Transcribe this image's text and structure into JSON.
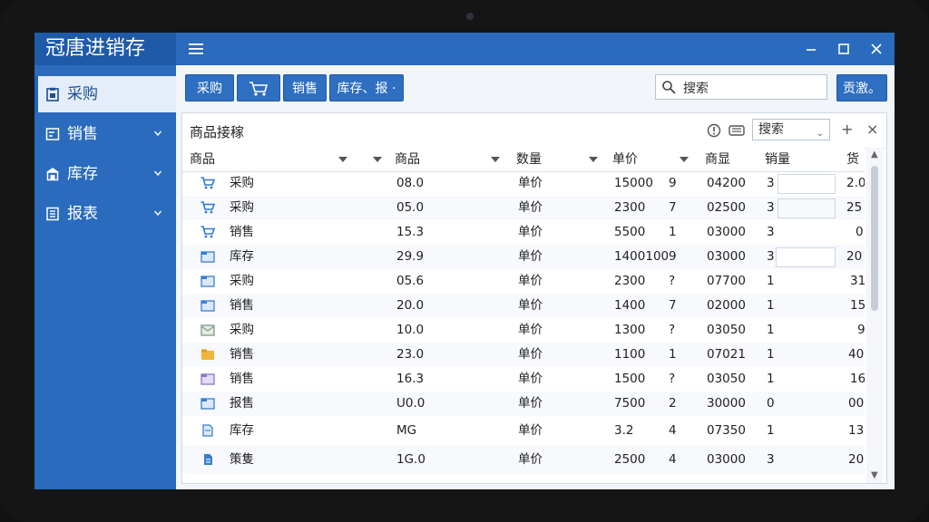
{
  "app": {
    "title": "冠唐进销存"
  },
  "sidebar": {
    "items": [
      {
        "label": "采购",
        "active": true
      },
      {
        "label": "销售",
        "active": false
      },
      {
        "label": "库存",
        "active": false
      },
      {
        "label": "报表",
        "active": false
      }
    ]
  },
  "toolbar": {
    "buttons": [
      "采购",
      "",
      "销售",
      "库存、报 ·",
      "贡激。"
    ],
    "search_value": "搜索"
  },
  "panel": {
    "title": "商品接稼",
    "select_value": "搜索",
    "plus": "+",
    "close": "×"
  },
  "table": {
    "headers": [
      "商品",
      "商品",
      "数量",
      "单价",
      "商显",
      "销量",
      "货"
    ],
    "rows": [
      [
        "采购",
        "08.0",
        "单价",
        "15000",
        "9",
        "04200",
        "3",
        "2.0"
      ],
      [
        "采购",
        "05.0",
        "单价",
        "2300",
        "7",
        "02500",
        "3",
        "25"
      ],
      [
        "销售",
        "15.3",
        "单价",
        "5500",
        "1",
        "03000",
        "3",
        "0"
      ],
      [
        "库存",
        "29.9",
        "单价",
        "1400100",
        "9",
        "03000",
        "3",
        "20"
      ],
      [
        "采购",
        "05.6",
        "单价",
        "2300",
        "?",
        "07700",
        "1",
        "31"
      ],
      [
        "销售",
        "20.0",
        "单价",
        "1400",
        "7",
        "02000",
        "1",
        "15"
      ],
      [
        "采购",
        "10.0",
        "单价",
        "1300",
        "?",
        "03050",
        "1",
        "9"
      ],
      [
        "销售",
        "23.0",
        "单价",
        "1100",
        "1",
        "07021",
        "1",
        "40"
      ],
      [
        "销售",
        "16.3",
        "单价",
        "1500",
        "?",
        "03050",
        "1",
        "16"
      ],
      [
        "报售",
        "U0.0",
        "单价",
        "7500",
        "2",
        "30000",
        "0",
        "00"
      ],
      [
        "库存",
        "MG",
        "单价",
        "3.2",
        "4",
        "07350",
        "1",
        "13"
      ],
      [
        "策隻",
        "1G.0",
        "单价",
        "2500",
        "4",
        "03000",
        "3",
        "20"
      ]
    ]
  },
  "colors": {
    "brand": "#2a6bbd",
    "brand_dark": "#1e5aa8",
    "button": "#2f6fc2",
    "cart_icon": "#2f78d1",
    "folder_icon_yellow": "#f2b43a"
  }
}
